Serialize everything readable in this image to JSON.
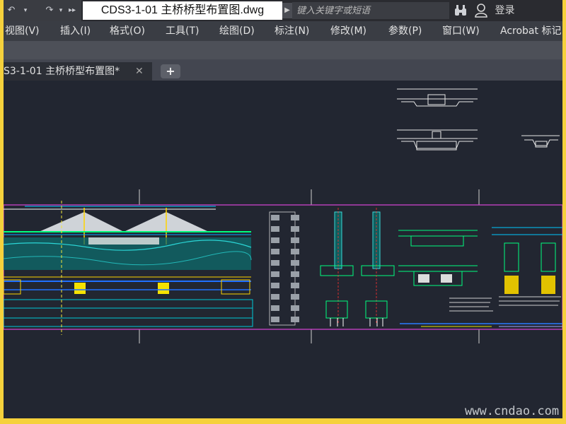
{
  "title_bar": {
    "document_title": "CDS3-1-01 主桥桥型布置图.dwg",
    "search_placeholder": "键入关键字或短语",
    "login_label": "登录"
  },
  "menu": {
    "items": [
      {
        "label": "视图(V)"
      },
      {
        "label": "插入(I)"
      },
      {
        "label": "格式(O)"
      },
      {
        "label": "工具(T)"
      },
      {
        "label": "绘图(D)"
      },
      {
        "label": "标注(N)"
      },
      {
        "label": "修改(M)"
      },
      {
        "label": "参数(P)"
      },
      {
        "label": "窗口(W)"
      },
      {
        "label": "Acrobat 标记"
      }
    ]
  },
  "tabs": {
    "active_tab_label": "S3-1-01 主桥桥型布置图*",
    "close_symbol": "✕",
    "add_symbol": "+"
  },
  "canvas": {
    "background": "#222631",
    "watermark": "www.cndao.com"
  },
  "icons": {
    "undo": "undo-arrow-icon",
    "more": "double-chevron-right-icon",
    "binoculars": "binoculars-icon",
    "user": "user-icon"
  }
}
